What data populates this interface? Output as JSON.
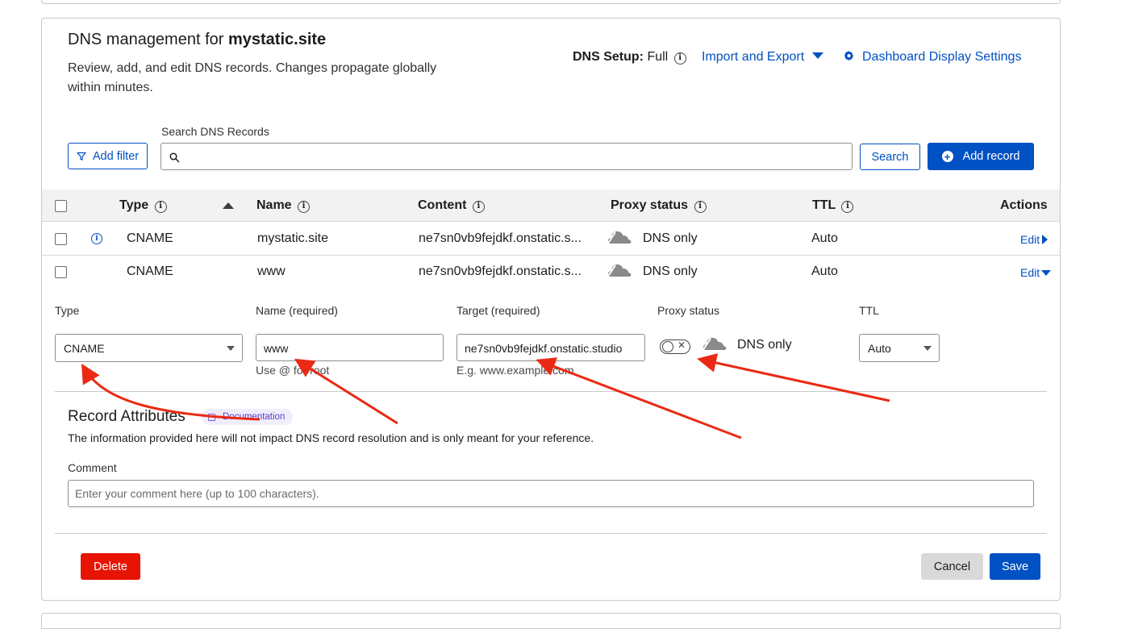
{
  "header": {
    "title_prefix": "DNS management for",
    "domain": "mystatic.site",
    "description": "Review, add, and edit DNS records. Changes propagate globally within minutes.",
    "dns_setup_label": "DNS Setup:",
    "dns_setup_value": "Full",
    "import_export": "Import and Export",
    "dashboard_settings": "Dashboard Display Settings"
  },
  "search": {
    "label": "Search DNS Records",
    "add_filter": "Add filter",
    "placeholder": "",
    "button": "Search",
    "add_record": "Add record"
  },
  "table": {
    "columns": [
      "Type",
      "Name",
      "Content",
      "Proxy status",
      "TTL",
      "Actions"
    ],
    "rows": [
      {
        "type": "CNAME",
        "name": "mystatic.site",
        "content": "ne7sn0vb9fejdkf.onstatic.s...",
        "proxy": "DNS only",
        "ttl": "Auto",
        "action": "Edit"
      },
      {
        "type": "CNAME",
        "name": "www",
        "content": "ne7sn0vb9fejdkf.onstatic.s...",
        "proxy": "DNS only",
        "ttl": "Auto",
        "action": "Edit"
      }
    ]
  },
  "edit_form": {
    "type_label": "Type",
    "type_value": "CNAME",
    "name_label": "Name (required)",
    "name_value": "www",
    "name_hint": "Use @ for root",
    "target_label": "Target (required)",
    "target_value": "ne7sn0vb9fejdkf.onstatic.studio",
    "target_hint": "E.g. www.example.com",
    "proxy_label": "Proxy status",
    "proxy_value": "DNS only",
    "proxied": false,
    "ttl_label": "TTL",
    "ttl_value": "Auto"
  },
  "attributes": {
    "title": "Record Attributes",
    "documentation": "Documentation",
    "description": "The information provided here will not impact DNS record resolution and is only meant for your reference.",
    "comment_label": "Comment",
    "comment_placeholder": "Enter your comment here (up to 100 characters).",
    "comment_value": ""
  },
  "actions": {
    "delete": "Delete",
    "cancel": "Cancel",
    "save": "Save"
  },
  "colors": {
    "accent": "#0051c3",
    "danger": "#e81403",
    "annotation_arrow": "#ea2a14"
  },
  "icons": {
    "info": "info-circle-icon",
    "gear": "gear-icon",
    "filter": "filter-icon",
    "search": "search-icon",
    "cloud": "cloud-icon"
  }
}
